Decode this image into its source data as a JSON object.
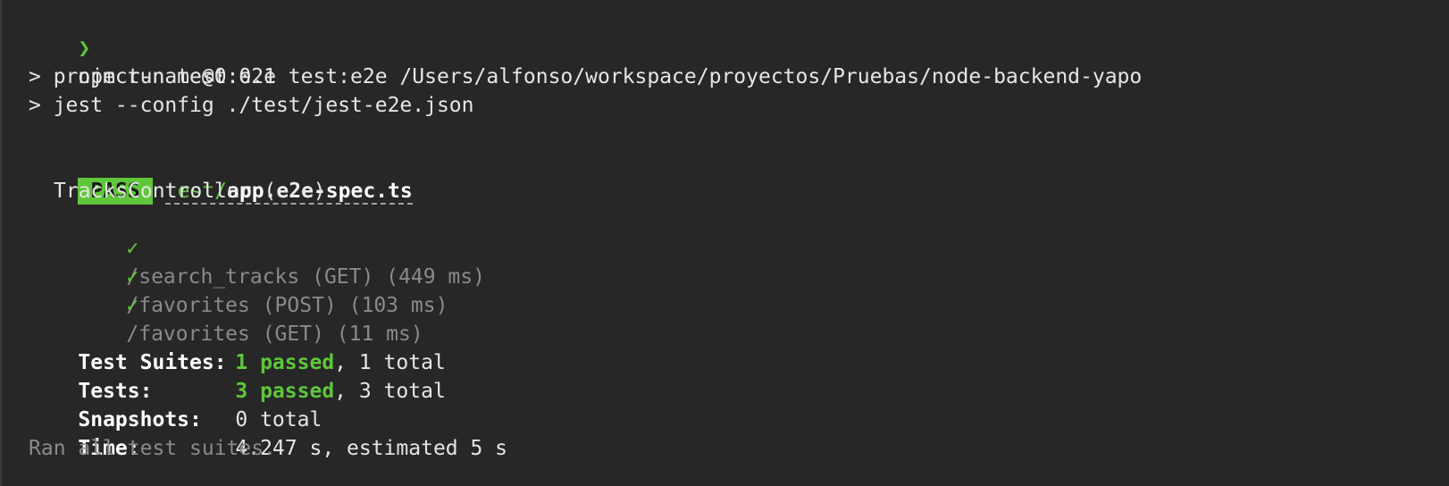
{
  "prompt": {
    "symbol": "❯",
    "command": "npm run test:e2e"
  },
  "script_lines": [
    "> project-name@0.0.1 test:e2e /Users/alfonso/workspace/proyectos/Pruebas/node-backend-yapo",
    "> jest --config ./test/jest-e2e.json"
  ],
  "result": {
    "badge": "PASS",
    "file_dir": "test/",
    "file_name": "app.e2e-spec.ts"
  },
  "suite": {
    "name": "TracksController (e2e)",
    "tests": [
      {
        "check": "✓",
        "label": "/search_tracks (GET) (449 ms)"
      },
      {
        "check": "✓",
        "label": "/favorites (POST) (103 ms)"
      },
      {
        "check": "✓",
        "label": "/favorites (GET) (11 ms)"
      }
    ]
  },
  "summary": {
    "suites_label": "Test Suites:",
    "suites_passed": "1 passed",
    "suites_total": ", 1 total",
    "tests_label": "Tests:",
    "tests_passed": "3 passed",
    "tests_total": ", 3 total",
    "snapshots_label": "Snapshots:",
    "snapshots_value": "0 total",
    "time_label": "Time:",
    "time_value": "4.247 s, estimated 5 s",
    "footer": "Ran all test suites."
  },
  "colors": {
    "background": "#272727",
    "accent_green": "#5ec73a",
    "text": "#e6e6e6",
    "muted": "#8a8a8a"
  }
}
